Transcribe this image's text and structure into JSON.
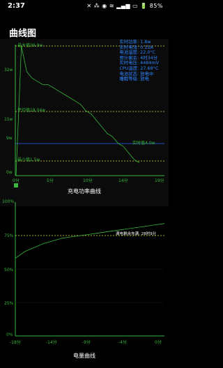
{
  "status_bar": {
    "time": "2:37",
    "battery": "85",
    "icons": "✕ ⁂ ◉ ≋ ▂▄▆ ▭"
  },
  "app": {
    "title": "曲线图"
  },
  "power_chart": {
    "title": "充电功率曲线",
    "y_labels": [
      "32w",
      "15w",
      "9w",
      "0w"
    ],
    "x_labels": [
      "0分",
      "5分",
      "10分",
      "14分",
      "19分"
    ],
    "max_label": "最大值39.9w",
    "avg_label": "平均值18.04w",
    "min_label": "最小值1.5w",
    "current_label": "实时值4.0w",
    "info": [
      "实时功率: 1.8w",
      "实时电流: 0.15A",
      "电池温度: 22.0°C",
      "预计剩余: 4时34分",
      "实时电压: 4484mV",
      "CPU温度: 27.68°C",
      "电池状态: 放电中",
      "睡眠等级: 放电"
    ]
  },
  "battery_chart": {
    "title": "电量曲线",
    "y_labels": [
      "100%",
      "75%",
      "50%",
      "25%",
      "0%"
    ],
    "x_labels": [
      "-18分",
      "-14分",
      "-9分",
      "-4分",
      "0分"
    ],
    "estimate_label": "满电剩余充满: 28时9分"
  },
  "colors": {
    "accent_green": "#37b83b",
    "info_blue": "#2d85ff",
    "dashed_yellow": "#e0e040"
  },
  "chart_data": [
    {
      "type": "line",
      "title": "充电功率曲线",
      "xlabel": "",
      "ylabel": "",
      "x_ticks": [
        "0分",
        "5分",
        "10分",
        "14分",
        "19分"
      ],
      "y_ticks": [
        "32w",
        "15w",
        "9w",
        "0w"
      ],
      "series": [
        {
          "values": [
            39.9,
            32,
            30,
            29,
            28,
            28,
            27,
            26,
            25,
            24,
            23,
            22,
            20,
            19,
            17,
            15,
            13,
            12,
            10,
            9,
            7,
            5,
            4
          ]
        }
      ],
      "annotations": {
        "max": 39.9,
        "avg": 18.04,
        "min": 1.5,
        "current": 4.0
      }
    },
    {
      "type": "line",
      "title": "电量曲线",
      "xlabel": "",
      "ylabel": "",
      "x_ticks": [
        "-18分",
        "-14分",
        "-9分",
        "-4分",
        "0分"
      ],
      "y_ticks": [
        "100%",
        "75%",
        "50%",
        "25%",
        "0%"
      ],
      "series": [
        {
          "values": [
            58,
            63,
            66,
            69,
            71,
            73,
            74,
            75,
            76,
            77,
            78,
            79,
            80,
            81,
            82,
            83,
            84
          ]
        }
      ]
    }
  ]
}
